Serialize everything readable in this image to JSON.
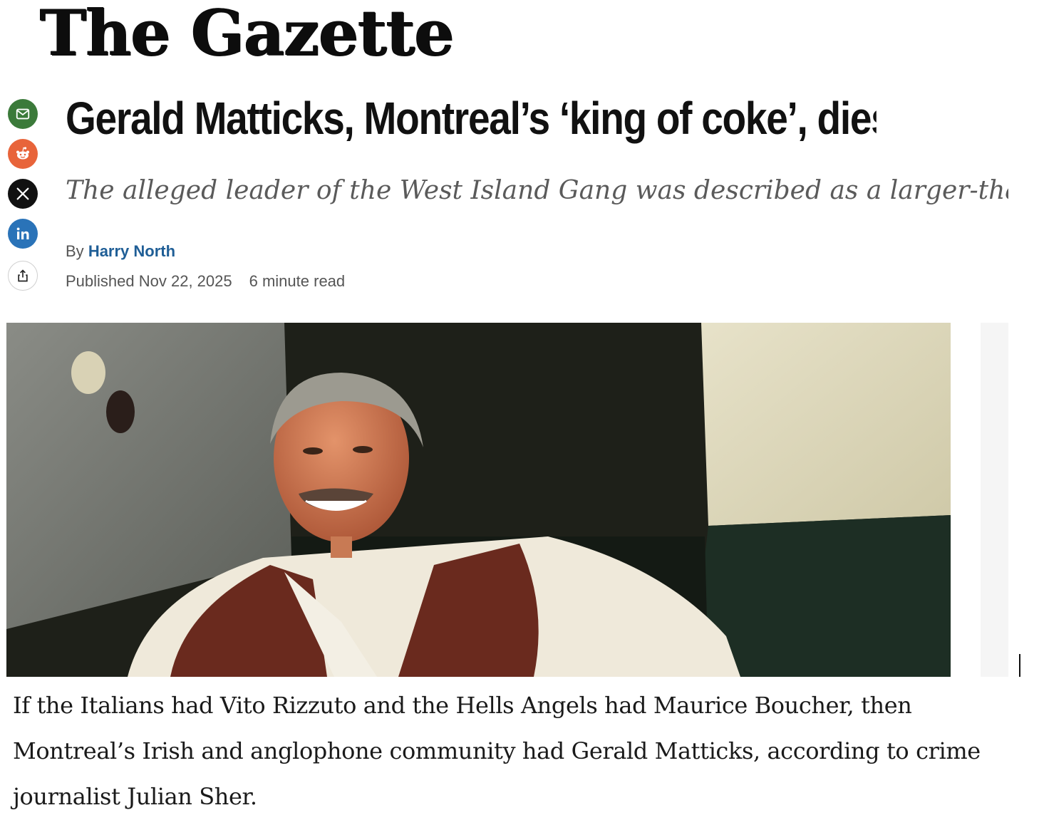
{
  "masthead": {
    "title": "The Gazette"
  },
  "share": {
    "items": [
      {
        "icon": "mail-icon",
        "color": "#3b7a3a"
      },
      {
        "icon": "reddit-icon",
        "color": "#e8643a"
      },
      {
        "icon": "x-icon",
        "color": "#111111"
      },
      {
        "icon": "linkedin-icon",
        "color": "#2a73b8"
      },
      {
        "icon": "share-icon",
        "color": "#ffffff"
      }
    ]
  },
  "article": {
    "headline": "Gerald Matticks, Montreal’s ‘king of coke’, dies at",
    "deck": "The alleged leader of the West Island Gang was described as a larger-than-life figure",
    "byline_prefix": "By",
    "author": "Harry North",
    "published": "Published Nov 22, 2025",
    "read_time": "6 minute read",
    "body": "If the Italians had Vito Rizzuto and the Hells Angels had Maurice Boucher, then Montreal’s Irish and anglophone community had Gerald Matticks, according to crime journalist Julian Sher."
  }
}
